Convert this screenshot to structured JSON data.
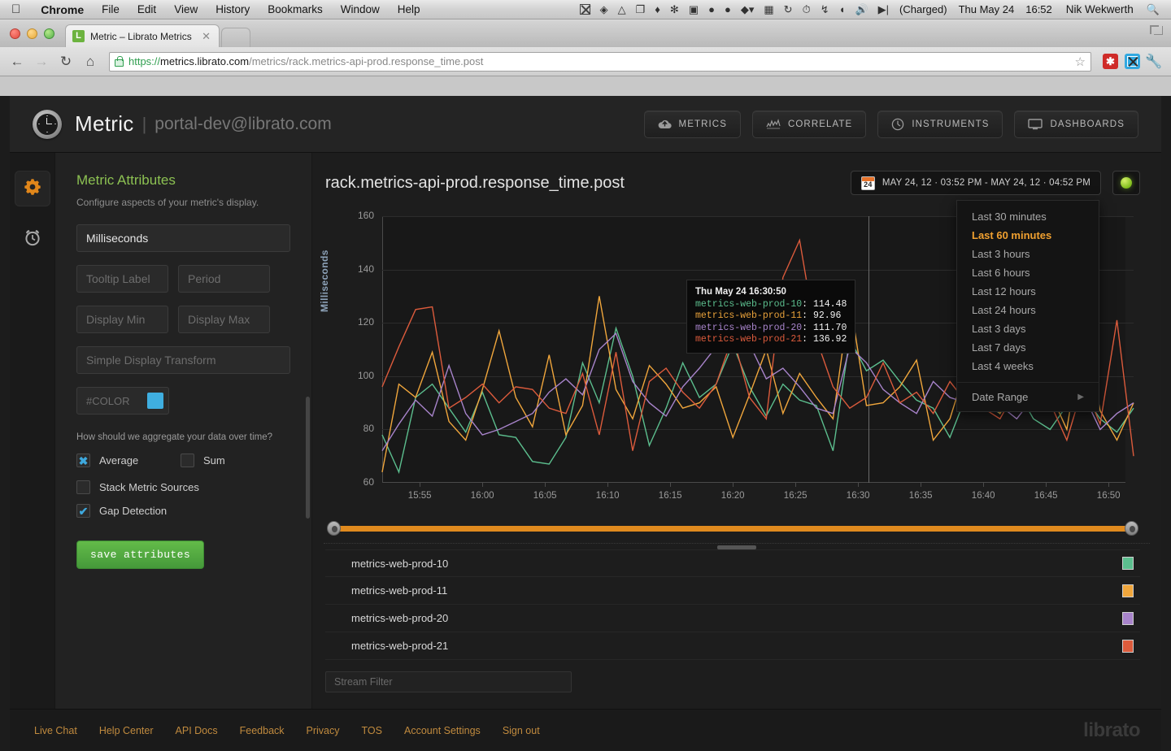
{
  "os_menu": {
    "apple_icon": "apple-logo",
    "items": [
      "Chrome",
      "File",
      "Edit",
      "View",
      "History",
      "Bookmarks",
      "Window",
      "Help"
    ],
    "status_icons": [
      "x-app-icon",
      "dropbox-icon",
      "google-drive-icon",
      "copy-icon",
      "flame-icon",
      "paw-icon",
      "screen-icon",
      "shield-icon",
      "circle-icon",
      "leaf-icon",
      "battery-meter-icon",
      "sync-icon",
      "clock-alert-icon",
      "bluetooth-icon",
      "wifi-icon",
      "volume-icon",
      "power-icon"
    ],
    "battery": "(Charged)",
    "date": "Thu May 24",
    "time": "16:52",
    "user": "Nik Wekwerth",
    "search_icon": "search-icon"
  },
  "browser": {
    "tab_title": "Metric – Librato Metrics",
    "tab_favicon_letter": "L",
    "close_icon": "close-icon",
    "back_icon": "back-arrow-icon",
    "forward_icon": "forward-arrow-icon",
    "reload_icon": "reload-icon",
    "home_icon": "home-icon",
    "lock_icon": "lock-icon",
    "url_scheme": "https://",
    "url_host": "metrics.librato.com",
    "url_path": "/metrics/rack.metrics-api-prod.response_time.post",
    "bookmark_icon": "star-icon",
    "ext1_icon": "extension-red-icon",
    "ext2_icon": "extension-blue-icon",
    "wrench_icon": "wrench-icon"
  },
  "app_header": {
    "logo_icon": "clock-logo-icon",
    "title": "Metric",
    "separator": "|",
    "account": "portal-dev@librato.com",
    "nav": [
      {
        "label": "METRICS",
        "icon": "cloud-icon"
      },
      {
        "label": "CORRELATE",
        "icon": "sparkline-icon"
      },
      {
        "label": "INSTRUMENTS",
        "icon": "gauge-icon"
      },
      {
        "label": "DASHBOARDS",
        "icon": "monitor-icon"
      }
    ]
  },
  "rail": {
    "items": [
      {
        "icon": "gear-icon",
        "active": true
      },
      {
        "icon": "alarm-clock-icon",
        "active": false
      }
    ]
  },
  "attributes": {
    "heading": "Metric Attributes",
    "description": "Configure aspects of your metric's display.",
    "display_name_value": "Milliseconds",
    "tooltip_label_placeholder": "Tooltip Label",
    "period_placeholder": "Period",
    "display_min_placeholder": "Display Min",
    "display_max_placeholder": "Display Max",
    "transform_placeholder": "Simple Display Transform",
    "color_placeholder": "#COLOR",
    "color_swatch": "#3FAEE0",
    "aggregate_question": "How should we aggregate your data over time?",
    "checkboxes": [
      {
        "label": "Average",
        "checked": true,
        "mark": "✖"
      },
      {
        "label": "Sum",
        "checked": false,
        "mark": ""
      },
      {
        "label": "Stack Metric Sources",
        "checked": false,
        "mark": ""
      },
      {
        "label": "Gap Detection",
        "checked": true,
        "mark": "✔"
      }
    ],
    "save_label": "save attributes"
  },
  "chart_header": {
    "title": "rack.metrics-api-prod.response_time.post",
    "calendar_icon": "calendar-icon",
    "calendar_day": "24",
    "date_range": "MAY 24, 12 · 03:52 PM - MAY 24, 12 · 04:52 PM",
    "status_icon": "status-dot-green"
  },
  "dropdown": {
    "items": [
      {
        "label": "Last 30 minutes",
        "selected": false
      },
      {
        "label": "Last 60 minutes",
        "selected": true
      },
      {
        "label": "Last 3 hours",
        "selected": false
      },
      {
        "label": "Last 6 hours",
        "selected": false
      },
      {
        "label": "Last 12 hours",
        "selected": false
      },
      {
        "label": "Last 24 hours",
        "selected": false
      },
      {
        "label": "Last 3 days",
        "selected": false
      },
      {
        "label": "Last 7 days",
        "selected": false
      },
      {
        "label": "Last 4 weeks",
        "selected": false
      }
    ],
    "date_range_label": "Date Range",
    "submenu_arrow": "chevron-right-icon"
  },
  "tooltip": {
    "timestamp": "Thu May 24 16:30:50",
    "rows": [
      {
        "name": "metrics-web-prod-10",
        "value": "114.48",
        "color": "#5CBE8E"
      },
      {
        "name": "metrics-web-prod-11",
        "value": "92.96",
        "color": "#E8A13A"
      },
      {
        "name": "metrics-web-prod-20",
        "value": "111.70",
        "color": "#A884CB"
      },
      {
        "name": "metrics-web-prod-21",
        "value": "136.92",
        "color": "#DC5B3C"
      }
    ]
  },
  "legend": {
    "rows": [
      {
        "name": "metrics-web-prod-10",
        "color": "#5CBE8E"
      },
      {
        "name": "metrics-web-prod-11",
        "color": "#F0A63C"
      },
      {
        "name": "metrics-web-prod-20",
        "color": "#A884CB"
      },
      {
        "name": "metrics-web-prod-21",
        "color": "#DC5B3C"
      }
    ],
    "filter_placeholder": "Stream Filter"
  },
  "footer": {
    "links": [
      "Live Chat",
      "Help Center",
      "API Docs",
      "Feedback",
      "Privacy",
      "TOS",
      "Account Settings",
      "Sign out"
    ],
    "logo": "librato"
  },
  "chart_data": {
    "type": "line",
    "title": "rack.metrics-api-prod.response_time.post",
    "xlabel": "",
    "ylabel": "Milliseconds",
    "ylim": [
      60,
      160
    ],
    "yticks": [
      60,
      80,
      100,
      120,
      140,
      160
    ],
    "xticks": [
      "15:55",
      "16:00",
      "16:05",
      "16:10",
      "16:15",
      "16:20",
      "16:25",
      "16:30",
      "16:35",
      "16:40",
      "16:45",
      "16:50"
    ],
    "xlim": [
      "15:52",
      "16:52"
    ],
    "grid": true,
    "legend_position": "below-chart",
    "series": [
      {
        "name": "metrics-web-prod-10",
        "color": "#5CBE8E",
        "values": [
          78,
          64,
          92,
          97,
          88,
          79,
          94,
          78,
          77,
          68,
          67,
          77,
          105,
          90,
          118,
          100,
          74,
          88,
          105,
          92,
          97,
          112,
          96,
          85,
          97,
          91,
          89,
          72,
          114,
          102,
          106,
          98,
          91,
          88,
          77,
          93,
          90,
          86,
          95,
          84,
          80,
          89,
          93,
          84,
          79,
          88
        ]
      },
      {
        "name": "metrics-web-prod-11",
        "color": "#F0A63C",
        "values": [
          64,
          97,
          92,
          109,
          83,
          76,
          95,
          117,
          92,
          81,
          108,
          78,
          89,
          130,
          95,
          84,
          104,
          97,
          88,
          90,
          96,
          77,
          93,
          110,
          86,
          101,
          92,
          84,
          129,
          89,
          90,
          96,
          106,
          76,
          84,
          104,
          92,
          86,
          97,
          88,
          94,
          80,
          119,
          87,
          76,
          90
        ]
      },
      {
        "name": "metrics-web-prod-20",
        "color": "#A884CB",
        "values": [
          72,
          82,
          91,
          85,
          104,
          86,
          78,
          80,
          83,
          86,
          94,
          99,
          93,
          110,
          116,
          98,
          90,
          85,
          96,
          103,
          111,
          128,
          112,
          99,
          103,
          96,
          88,
          86,
          111,
          105,
          95,
          90,
          86,
          98,
          92,
          90,
          95,
          89,
          84,
          92,
          87,
          98,
          93,
          80,
          86,
          90
        ]
      },
      {
        "name": "metrics-web-prod-21",
        "color": "#DC5B3C",
        "values": [
          96,
          111,
          125,
          126,
          88,
          92,
          97,
          90,
          96,
          95,
          88,
          86,
          101,
          78,
          109,
          72,
          98,
          103,
          94,
          88,
          97,
          115,
          92,
          84,
          137,
          151,
          114,
          96,
          88,
          92,
          105,
          90,
          94,
          86,
          98,
          90,
          88,
          84,
          95,
          118,
          90,
          76,
          97,
          82,
          121,
          70
        ]
      }
    ]
  }
}
